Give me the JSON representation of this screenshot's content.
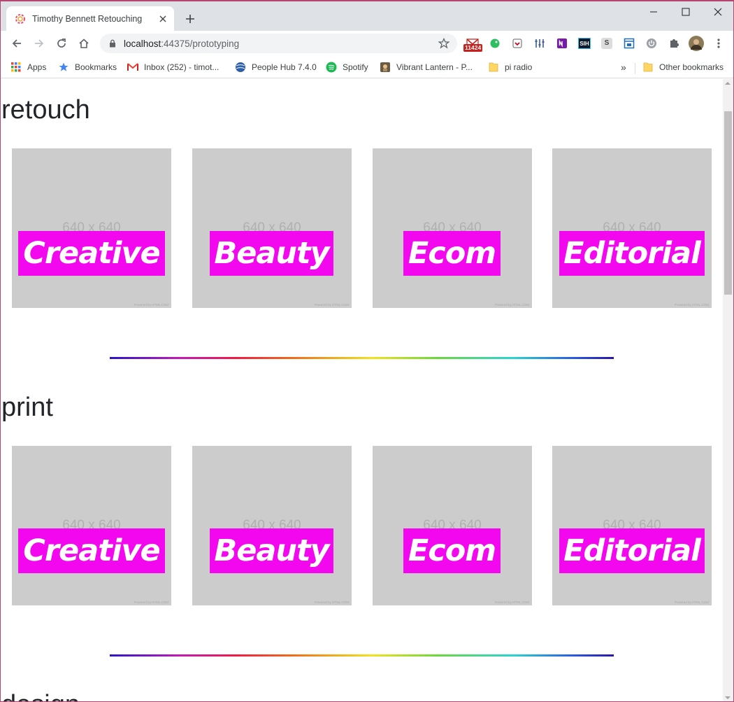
{
  "browser": {
    "tab_title": "Timothy Bennett Retouching",
    "url_host": "localhost",
    "url_port_path": ":44375/prototyping",
    "gmail_badge": "11424",
    "ext_labels": {
      "sih": "SIH",
      "s": "S"
    },
    "bookmarks": [
      {
        "label": "Apps",
        "icon": "apps-grid-icon"
      },
      {
        "label": "Bookmarks",
        "icon": "star-icon"
      },
      {
        "label": "Inbox (252) - timot...",
        "icon": "gmail-icon"
      },
      {
        "label": "People Hub 7.4.0",
        "icon": "globe-icon"
      },
      {
        "label": "Spotify",
        "icon": "spotify-icon"
      },
      {
        "label": "Vibrant Lantern - P...",
        "icon": "lantern-icon"
      },
      {
        "label": "pi radio",
        "icon": "folder-icon"
      }
    ],
    "overflow_label": "»",
    "other_bookmarks": "Other bookmarks"
  },
  "colors": {
    "tag_bg": "#f207ee",
    "placeholder_bg": "#cccccc",
    "frame": "#b54671"
  },
  "placeholder": {
    "size_text": "640 x 640",
    "footer": "Powered by HTML.COM"
  },
  "sections": [
    {
      "title": "retouch",
      "cards": [
        "Creative",
        "Beauty",
        "Ecom",
        "Editorial"
      ]
    },
    {
      "title": "print",
      "cards": [
        "Creative",
        "Beauty",
        "Ecom",
        "Editorial"
      ]
    },
    {
      "title": "design"
    }
  ]
}
